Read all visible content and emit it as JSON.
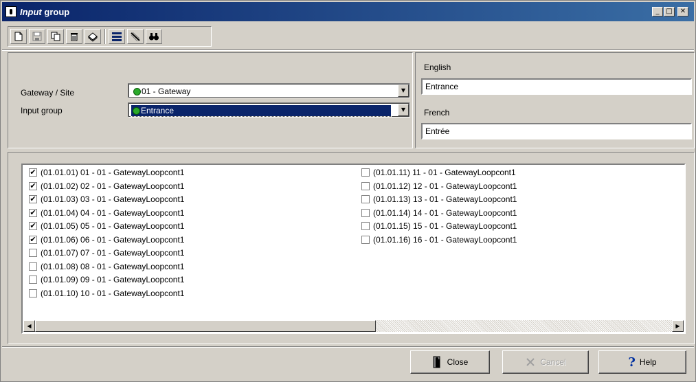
{
  "window": {
    "title_italic": "Input",
    "title_rest": " group",
    "min": "_",
    "max": "□",
    "close": "✕"
  },
  "toolbar": {
    "icons": [
      "new-icon",
      "save-icon",
      "copy-icon",
      "delete-icon",
      "print-icon",
      "list-icon",
      "link-icon",
      "find-icon"
    ]
  },
  "form": {
    "gateway_label": "Gateway / Site",
    "gateway_value": "01 - Gateway",
    "input_group_label": "Input group",
    "input_group_value": "Entrance",
    "english_label": "English",
    "english_value": "Entrance",
    "french_label": "French",
    "french_value": "Entrée"
  },
  "inputs": {
    "left": [
      {
        "label": "(01.01.01) 01 - 01 - GatewayLoopcont1",
        "checked": true
      },
      {
        "label": "(01.01.02) 02 - 01 - GatewayLoopcont1",
        "checked": true
      },
      {
        "label": "(01.01.03) 03 - 01 - GatewayLoopcont1",
        "checked": true
      },
      {
        "label": "(01.01.04) 04 - 01 - GatewayLoopcont1",
        "checked": true
      },
      {
        "label": "(01.01.05) 05 - 01 - GatewayLoopcont1",
        "checked": true
      },
      {
        "label": "(01.01.06) 06 - 01 - GatewayLoopcont1",
        "checked": true
      },
      {
        "label": "(01.01.07) 07 - 01 - GatewayLoopcont1",
        "checked": false
      },
      {
        "label": "(01.01.08) 08 - 01 - GatewayLoopcont1",
        "checked": false
      },
      {
        "label": "(01.01.09) 09 - 01 - GatewayLoopcont1",
        "checked": false
      },
      {
        "label": "(01.01.10) 10 - 01 - GatewayLoopcont1",
        "checked": false
      }
    ],
    "right": [
      {
        "label": "(01.01.11) 11 - 01 - GatewayLoopcont1",
        "checked": false
      },
      {
        "label": "(01.01.12) 12 - 01 - GatewayLoopcont1",
        "checked": false
      },
      {
        "label": "(01.01.13) 13 - 01 - GatewayLoopcont1",
        "checked": false
      },
      {
        "label": "(01.01.14) 14 - 01 - GatewayLoopcont1",
        "checked": false
      },
      {
        "label": "(01.01.15) 15 - 01 - GatewayLoopcont1",
        "checked": false
      },
      {
        "label": "(01.01.16) 16 - 01 - GatewayLoopcont1",
        "checked": false
      }
    ]
  },
  "buttons": {
    "close": "Close",
    "cancel": "Cancel",
    "help": "Help"
  },
  "colors": {
    "title_bar": "#0a246a",
    "face": "#d4d0c8",
    "status_dot": "#2aaa2a"
  }
}
